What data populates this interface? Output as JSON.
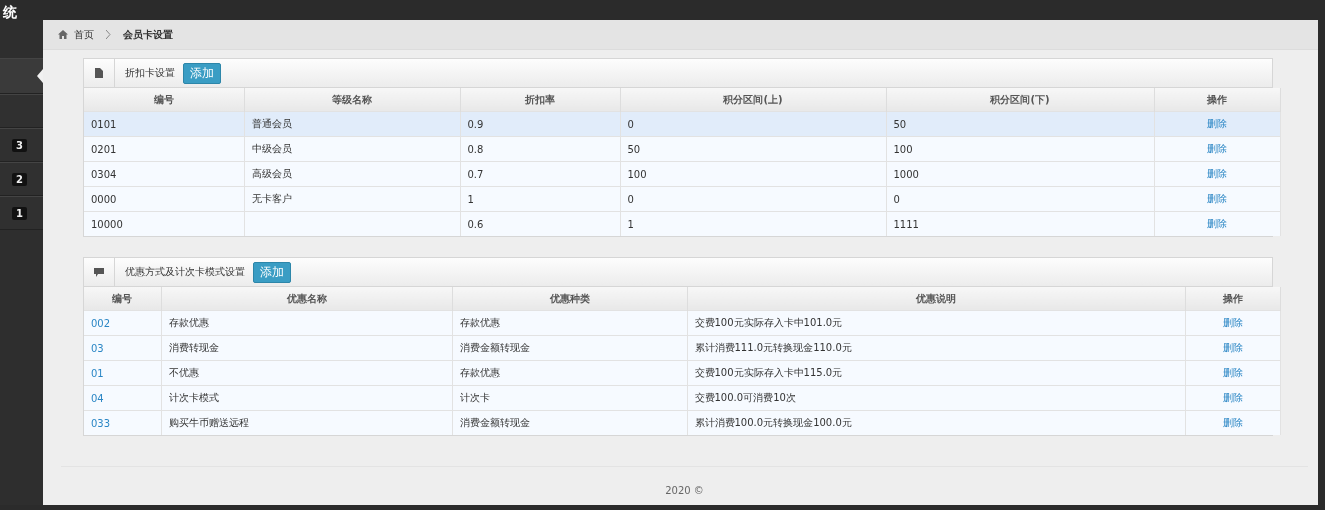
{
  "header": {
    "title": "统"
  },
  "sidebar": {
    "items": [
      {
        "selected": true
      },
      {
        "selected": false
      },
      {
        "selected": false,
        "badge": "3"
      },
      {
        "selected": false,
        "badge": "2"
      },
      {
        "selected": false,
        "badge": "1"
      }
    ]
  },
  "breadcrumb": {
    "home": "首页",
    "current": "会员卡设置"
  },
  "panels": [
    {
      "title": "折扣卡设置",
      "add_button": "添加",
      "columns": [
        "编号",
        "等级名称",
        "折扣率",
        "积分区间(上)",
        "积分区间(下)",
        "操作"
      ],
      "rows": [
        {
          "selected": true,
          "cells": [
            "0101",
            "普通会员",
            "0.9",
            "0",
            "50",
            "删除"
          ]
        },
        {
          "selected": false,
          "cells": [
            "0201",
            "中级会员",
            "0.8",
            "50",
            "100",
            "删除"
          ]
        },
        {
          "selected": false,
          "cells": [
            "0304",
            "高级会员",
            "0.7",
            "100",
            "1000",
            "删除"
          ]
        },
        {
          "selected": false,
          "cells": [
            "0000",
            "无卡客户",
            "1",
            "0",
            "0",
            "删除"
          ]
        },
        {
          "selected": false,
          "cells": [
            "10000",
            null,
            "0.6",
            "1",
            "1111",
            "删除"
          ]
        }
      ]
    },
    {
      "title": "优惠方式及计次卡模式设置",
      "add_button": "添加",
      "columns": [
        "编号",
        "优惠名称",
        "优惠种类",
        "优惠说明",
        "操作"
      ],
      "rows": [
        {
          "selected": false,
          "cells": [
            "002",
            "存款优惠",
            "存款优惠",
            "交费100元实际存入卡中101.0元",
            "删除"
          ]
        },
        {
          "selected": false,
          "cells": [
            "03",
            "消费转现金",
            "消费金额转现金",
            "累计消费111.0元转换现金110.0元",
            "删除"
          ]
        },
        {
          "selected": false,
          "cells": [
            "01",
            "不优惠",
            "存款优惠",
            "交费100元实际存入卡中115.0元",
            "删除"
          ]
        },
        {
          "selected": false,
          "cells": [
            "04",
            "计次卡模式",
            "计次卡",
            "交费100.0可消费10次",
            "删除"
          ]
        },
        {
          "selected": false,
          "cells": [
            "033",
            "购买牛币赠送远程",
            "消费金额转现金",
            "累计消费100.0元转换现金100.0元",
            "删除"
          ]
        }
      ]
    }
  ],
  "footer": {
    "text": "2020 ©"
  }
}
